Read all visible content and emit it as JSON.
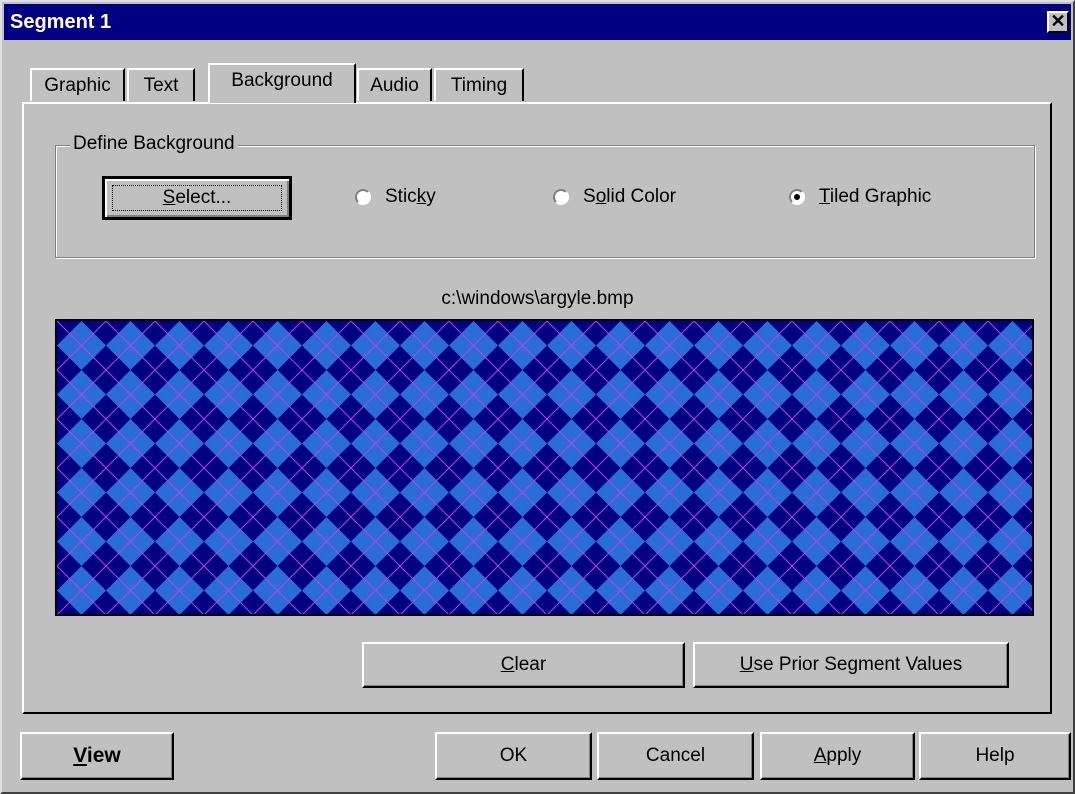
{
  "window": {
    "title": "Segment 1",
    "close_glyph": "✕"
  },
  "tabs": [
    {
      "label": "Graphic",
      "active": false
    },
    {
      "label": "Text",
      "active": false
    },
    {
      "label": "Background",
      "active": true
    },
    {
      "label": "Audio",
      "active": false
    },
    {
      "label": "Timing",
      "active": false
    }
  ],
  "group": {
    "label": "Define Background"
  },
  "select_button": {
    "label": "Select...",
    "underline": "S",
    "rest": "elect..."
  },
  "radios": [
    {
      "pre": "Stic",
      "u": "k",
      "post": "y",
      "checked": false
    },
    {
      "pre": "S",
      "u": "o",
      "post": "lid Color",
      "checked": false
    },
    {
      "pre": "",
      "u": "T",
      "post": "iled Graphic",
      "checked": true
    }
  ],
  "preview": {
    "filename": "c:\\windows\\argyle.bmp",
    "colors": {
      "base": "#000080",
      "diamond": "#2a6dd8",
      "lines": "#c040e0"
    }
  },
  "buttons": {
    "clear": {
      "u": "C",
      "rest": "lear"
    },
    "prior": {
      "u": "U",
      "rest": "se Prior Segment Values"
    },
    "view": {
      "u": "V",
      "rest": "iew"
    },
    "ok": "OK",
    "cancel": "Cancel",
    "apply": {
      "u": "A",
      "rest": "pply"
    },
    "help": "Help"
  }
}
